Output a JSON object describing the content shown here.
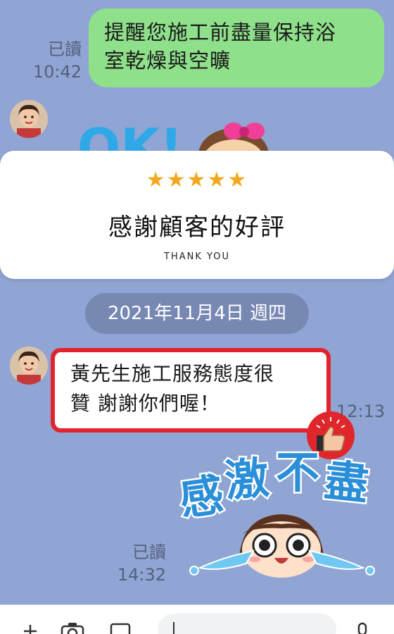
{
  "messages": {
    "outgoing_top": {
      "read_label": "已讀",
      "time": "10:42",
      "text_line1": "提醒您施工前盡量保持浴",
      "text_line2": "室乾燥與空曠"
    },
    "incoming": {
      "text_line1": "黃先生施工服務態度很",
      "text_line2": "贊  謝謝你們喔！",
      "time": "12:13"
    },
    "outgoing_bottom": {
      "read_label": "已讀",
      "time": "14:32"
    }
  },
  "review_card": {
    "stars": "★★★★★",
    "title": "感謝顧客的好評",
    "subtitle": "THANK YOU"
  },
  "date_separator": "2021年11月4日 週四",
  "stickers": {
    "top": "OK!",
    "bottom": "感激不盡"
  },
  "colors": {
    "chat_bg": "#90a5d3",
    "outgoing_bubble": "#8fe08a",
    "incoming_bubble": "#ffffff",
    "highlight_frame": "#e3232c",
    "star": "#f2a91f"
  },
  "icons": [
    "avatar-photo",
    "ok-sticker",
    "bow-icon",
    "thumbs-up-icon",
    "crying-face-sticker",
    "plus-icon",
    "camera-icon",
    "image-icon",
    "mic-icon"
  ]
}
